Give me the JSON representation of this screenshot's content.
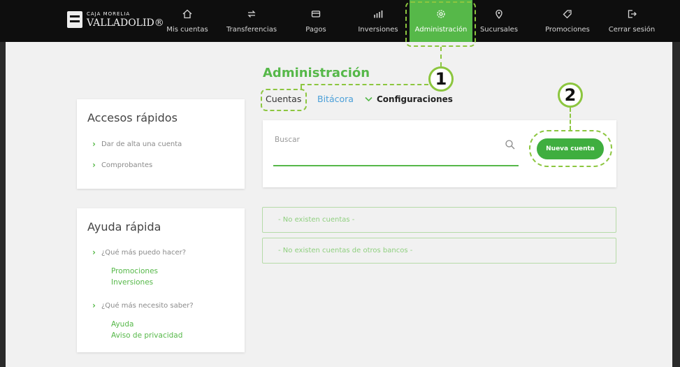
{
  "logo": {
    "top": "CAJA MORELIA",
    "bottom": "VALLADOLID®"
  },
  "nav": [
    {
      "label": "Mis cuentas",
      "icon": "home-icon"
    },
    {
      "label": "Transferencias",
      "icon": "transfer-icon"
    },
    {
      "label": "Pagos",
      "icon": "payments-icon"
    },
    {
      "label": "Inversiones",
      "icon": "investments-icon"
    },
    {
      "label": "Administración",
      "icon": "gear-icon"
    },
    {
      "label": "Sucursales",
      "icon": "location-icon"
    },
    {
      "label": "Promociones",
      "icon": "tag-icon"
    },
    {
      "label": "Cerrar sesión",
      "icon": "logout-icon"
    }
  ],
  "active_nav": "Administración",
  "accent_color": "#56b849",
  "page": {
    "title": "Administración",
    "tabs": [
      "Cuentas",
      "Bitácora",
      "Configuraciones"
    ]
  },
  "search": {
    "label": "Buscar"
  },
  "new_account_button": "Nueva cuenta",
  "empty_messages": [
    "- No existen cuentas -",
    "- No existen cuentas de otros bancos -"
  ],
  "quick_access": {
    "title": "Accesos rápidos",
    "items": [
      "Dar de alta una cuenta",
      "Comprobantes"
    ]
  },
  "quick_help": {
    "title": "Ayuda rápida",
    "sections": [
      {
        "question": "¿Qué más puedo hacer?",
        "links": [
          "Promociones",
          "Inversiones"
        ]
      },
      {
        "question": "¿Qué más necesito saber?",
        "links": [
          "Ayuda",
          "Aviso de privacidad"
        ]
      }
    ]
  },
  "callouts": [
    "1",
    "2"
  ]
}
